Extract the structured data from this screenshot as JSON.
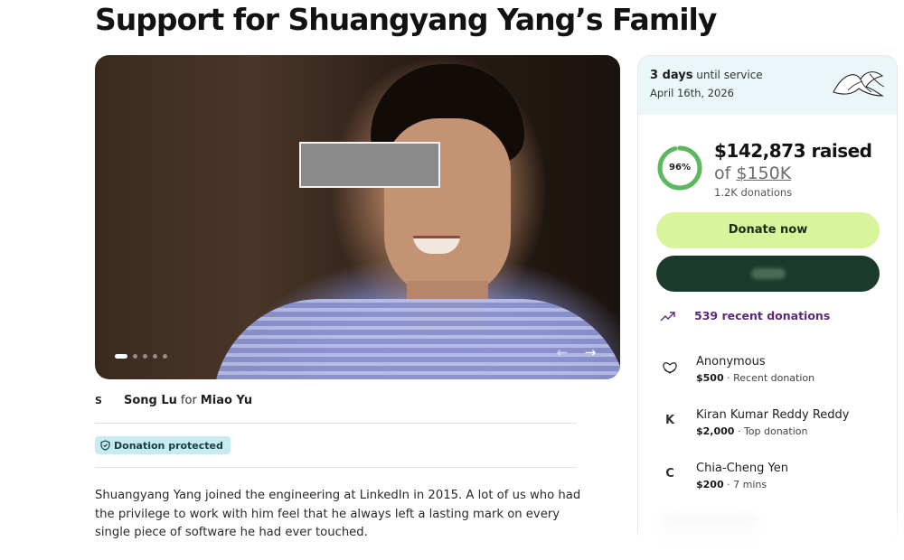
{
  "page": {
    "title": "Support for Shuangyang Yang’s Family"
  },
  "organizer": {
    "avatar_letter": "S",
    "name": "Song Lu",
    "for_word": "for",
    "beneficiary": "Miao Yu"
  },
  "badge": {
    "label": "Donation protected"
  },
  "story": {
    "text": "Shuangyang Yang joined the engineering at LinkedIn in 2015. A lot of us who had the privilege to work with him feel that he always left a lasting mark on every single piece of software he had ever touched."
  },
  "gallery": {
    "slide_count": 5,
    "active_slide": 1,
    "prev_icon": "arrow-left-icon",
    "next_icon": "arrow-right-icon"
  },
  "service": {
    "days": "3 days",
    "until_text": "until service",
    "date": "April 16th, 2026",
    "icon": "lily-flower-icon"
  },
  "fundraiser": {
    "percent_label": "96%",
    "progress_fraction": 0.96,
    "raised": "$142,873 raised",
    "of_word": "of",
    "goal": "$150K",
    "donations_count": "1.2K donations",
    "donate_label": "Donate now"
  },
  "recent": {
    "label": "539 recent donations",
    "icon": "trending-up-icon"
  },
  "donors": [
    {
      "icon_text": "",
      "icon": "heart-hands-icon",
      "name": "Anonymous",
      "amount": "$500",
      "note": " · Recent donation"
    },
    {
      "icon_text": "K",
      "icon": "",
      "name": "Kiran Kumar Reddy Reddy",
      "amount": "$2,000",
      "note": " · Top donation"
    },
    {
      "icon_text": "C",
      "icon": "",
      "name": "Chia-Cheng Yen",
      "amount": "$200",
      "note": " · 7 mins"
    }
  ],
  "colors": {
    "donate_button": "#d8f59b",
    "share_button": "#1a3a2c",
    "progress_ring": "#5cb85c",
    "badge_bg": "#c6ecef",
    "service_bg": "#eaf6f8",
    "recent_text": "#5c2a7a"
  }
}
